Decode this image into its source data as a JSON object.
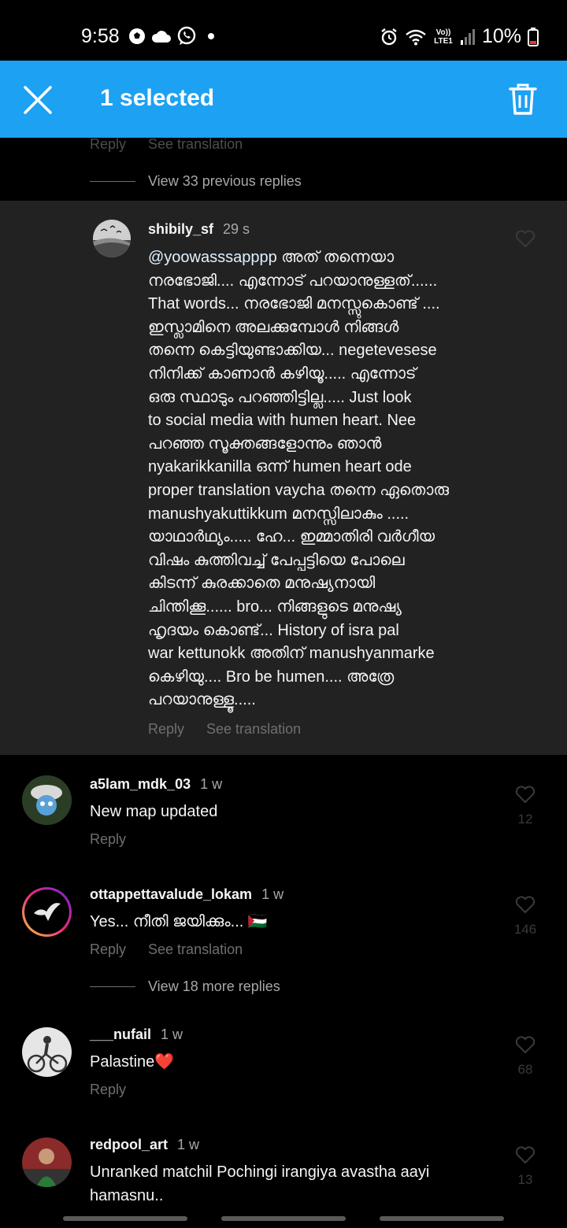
{
  "status_bar": {
    "time": "9:58",
    "volte": "Vo)) LTE1",
    "battery": "10%"
  },
  "selection_bar": {
    "title": "1 selected",
    "accent": "#1da1f2"
  },
  "top_thread": {
    "reply": "Reply",
    "see_translation": "See translation",
    "view_previous": "View 33 previous replies"
  },
  "selected_comment": {
    "username": "shibily_sf",
    "time": "29 s",
    "mention": "@yoowasssapppp",
    "text": " അത് തന്നെയാ\nനരഭോജി.... എന്നോട് പറയാനുള്ളത്......\nThat words...  നരഭോജി മനസ്സുകൊണ്ട് ....\nഇസ്ലാമിനെ അലക്കുമ്പോൾ നിങ്ങൾ\nതന്നെ കെട്ടിയുണ്ടാക്കിയ...  negetevesese\nനിനിക്ക് കാണാൻ കഴിയൂ.....  എന്നോട്\nഒരു സ്ഥാടും പറഞ്ഞിട്ടില്ല.....  Just look\nto social media with humen heart.  Nee\nപറഞ്ഞ സൂക്തങ്ങളോന്നും ഞാൻ\nnyakarikkanilla ഒന്ന് humen heart ode\nproper translation vaycha തന്നെ ഏതൊരു\nmanushyakuttikkum മനസ്സിലാകും .....\nയാഥാർഥ്യം..... ഹേ...  ഇമ്മാതിരി വർഗീയ\nവിഷം കുത്തിവച്ച് പേപ്പട്ടിയെ പോലെ\nകിടന്ന് കുരക്കാതെ മനുഷ്യനായി\nചിന്തിക്കൂ......       bro...  നിങ്ങളുടെ മനുഷ്യ\nഹൃദയം കൊണ്ട്...  History of isra pal\nwar kettunokk അതിന് manushyanmarke\nകെഴിയു.... Bro be humen.... അത്രേ\nപറയാനുള്ളൂ.....",
    "reply": "Reply",
    "see_translation": "See translation"
  },
  "comments": [
    {
      "username": "a5lam_mdk_03",
      "time": "1 w",
      "text": "New map updated",
      "reply": "Reply",
      "likes": "12"
    },
    {
      "username": "ottappettavalude_lokam",
      "time": "1 w",
      "text": "Yes... നീതി ജയിക്കും... 🇵🇸",
      "reply": "Reply",
      "see_translation": "See translation",
      "view_more": "View 18 more replies",
      "likes": "146"
    },
    {
      "username": "___nufail",
      "time": "1 w",
      "text": "Palastine❤️",
      "reply": "Reply",
      "likes": "68"
    },
    {
      "username": "redpool_art",
      "time": "1 w",
      "text": "Unranked matchil Pochingi irangiya avastha aayi\nhamasnu..",
      "likes": "13"
    }
  ]
}
